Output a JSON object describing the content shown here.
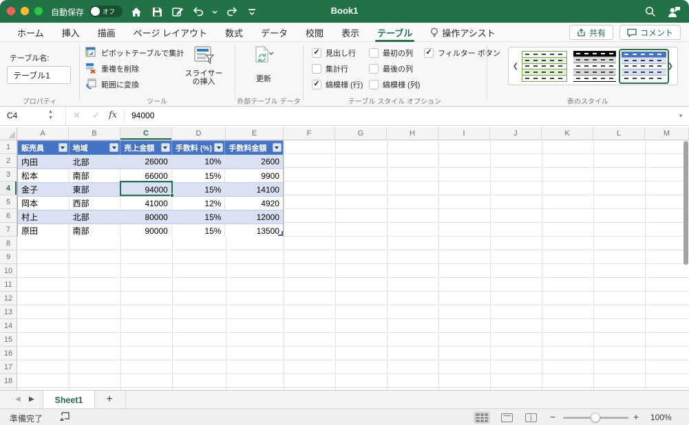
{
  "colors": {
    "titlebar_green": "#217346",
    "accent_green": "#217346",
    "table_header_blue": "#4472C4",
    "table_band_blue": "#D9E1F2",
    "selection_green": "#1E7145"
  },
  "titlebar": {
    "autosave_label": "自動保存",
    "autosave_state": "オフ",
    "title": "Book1"
  },
  "ribbon_tabs": [
    {
      "id": "home",
      "label": "ホーム",
      "active": false
    },
    {
      "id": "insert",
      "label": "挿入",
      "active": false
    },
    {
      "id": "draw",
      "label": "描画",
      "active": false
    },
    {
      "id": "page-layout",
      "label": "ページ レイアウト",
      "active": false
    },
    {
      "id": "formulas",
      "label": "数式",
      "active": false
    },
    {
      "id": "data",
      "label": "データ",
      "active": false
    },
    {
      "id": "review",
      "label": "校閲",
      "active": false
    },
    {
      "id": "view",
      "label": "表示",
      "active": false
    },
    {
      "id": "table",
      "label": "テーブル",
      "active": true
    },
    {
      "id": "assist",
      "label": "操作アシスト",
      "active": false,
      "icon": "lightbulb-icon"
    }
  ],
  "actions": {
    "share_label": "共有",
    "comment_label": "コメント"
  },
  "ribbon": {
    "properties_group": {
      "table_name_label": "テーブル名:",
      "table_name_value": "テーブル1",
      "group_label": "プロパティ"
    },
    "tools_group": {
      "items": [
        {
          "label": "ピボットテーブルで集計",
          "icon": "pivot-table-icon"
        },
        {
          "label": "重複を削除",
          "icon": "remove-duplicates-icon"
        },
        {
          "label": "範囲に変換",
          "icon": "convert-to-range-icon"
        }
      ],
      "slicer_label": "スライサーの挿入",
      "group_label": "ツール"
    },
    "external_data_group": {
      "refresh_label": "更新",
      "group_label": "外部テーブル データ"
    },
    "style_options_group": {
      "columns": [
        [
          {
            "label": "見出し行",
            "checked": true
          },
          {
            "label": "集計行",
            "checked": false
          },
          {
            "label": "縞模様 (行)",
            "checked": true
          }
        ],
        [
          {
            "label": "最初の列",
            "checked": false
          },
          {
            "label": "最後の列",
            "checked": false
          },
          {
            "label": "縞模様 (列)",
            "checked": false
          }
        ],
        [
          {
            "label": "フィルター ボタン",
            "checked": true
          }
        ]
      ],
      "group_label": "テーブル スタイル オプション"
    },
    "table_styles_group": {
      "group_label": "表のスタイル",
      "selected_style_index": 2
    }
  },
  "formula_bar": {
    "cell_reference": "C4",
    "formula_value": "94000"
  },
  "grid": {
    "columns": [
      "A",
      "B",
      "C",
      "D",
      "E",
      "F",
      "G",
      "H",
      "I",
      "J",
      "K",
      "L",
      "M"
    ],
    "row_count": 19,
    "selected_column": "C",
    "selected_row": 4,
    "table": {
      "headers": [
        "販売員",
        "地域",
        "売上金額",
        "手数料 (%)",
        "手数料金額"
      ],
      "rows": [
        [
          "内田",
          "北部",
          "26000",
          "10%",
          "2600"
        ],
        [
          "松本",
          "南部",
          "66000",
          "15%",
          "9900"
        ],
        [
          "金子",
          "東部",
          "94000",
          "15%",
          "14100"
        ],
        [
          "岡本",
          "西部",
          "41000",
          "12%",
          "4920"
        ],
        [
          "村上",
          "北部",
          "80000",
          "15%",
          "12000"
        ],
        [
          "原田",
          "南部",
          "90000",
          "15%",
          "13500"
        ]
      ]
    }
  },
  "sheet_bar": {
    "tabs": [
      {
        "label": "Sheet1",
        "active": true
      }
    ],
    "add_label": "+"
  },
  "status_bar": {
    "ready_label": "準備完了",
    "zoom_level": "100%"
  }
}
